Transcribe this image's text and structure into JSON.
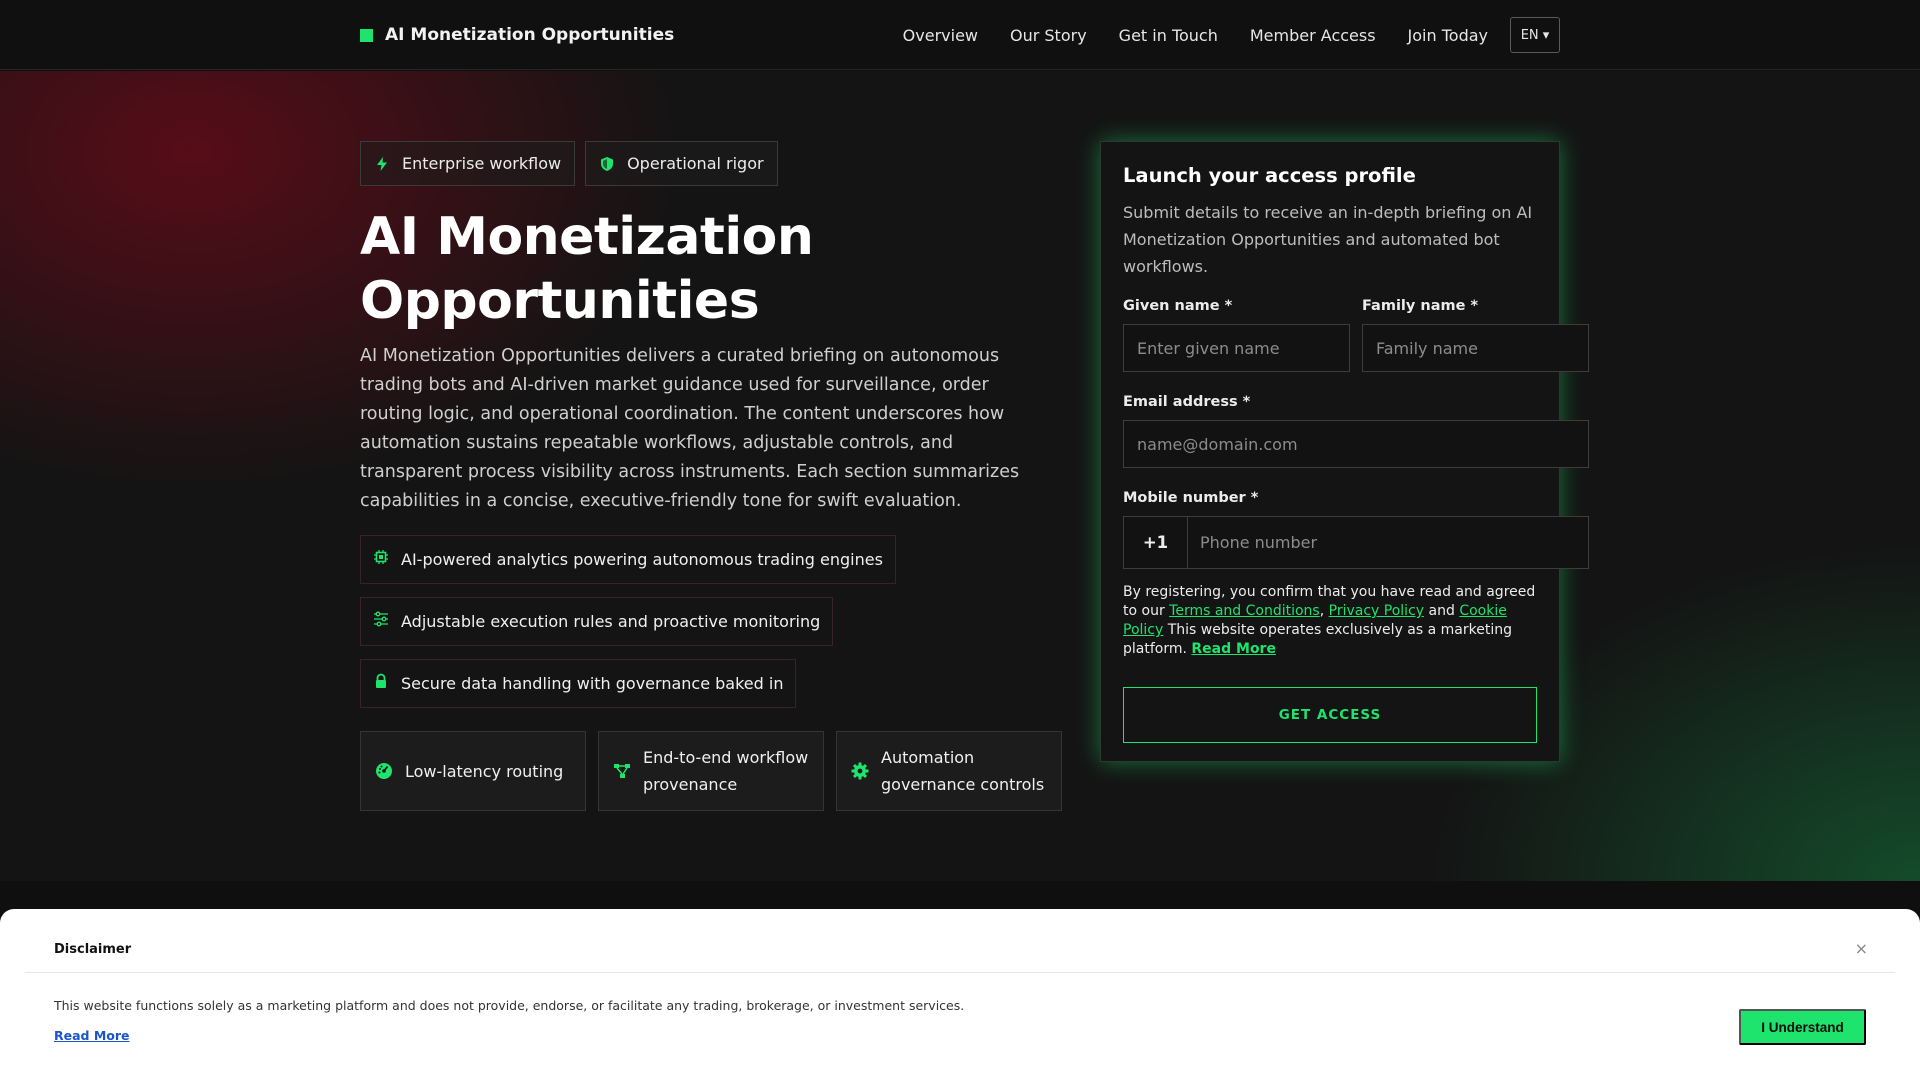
{
  "brand": {
    "name": "AI Monetization Opportunities"
  },
  "nav": {
    "links": [
      "Overview",
      "Our Story",
      "Get in Touch",
      "Member Access",
      "Join Today"
    ],
    "language": "EN ▾"
  },
  "hero": {
    "badges": [
      {
        "label": "Enterprise workflow",
        "icon": "bolt-icon"
      },
      {
        "label": "Operational rigor",
        "icon": "shield-icon"
      }
    ],
    "title": "AI Monetization Opportunities",
    "description": "AI Monetization Opportunities delivers a curated briefing on autonomous trading bots and AI-driven market guidance used for surveillance, order routing logic, and operational coordination. The content underscores how automation sustains repeatable workflows, adjustable controls, and transparent process visibility across instruments. Each section summarizes capabilities in a concise, executive-friendly tone for swift evaluation.",
    "features": [
      {
        "label": "AI-powered analytics powering autonomous trading engines",
        "icon": "chip-icon"
      },
      {
        "label": "Adjustable execution rules and proactive monitoring",
        "icon": "sliders-icon"
      },
      {
        "label": "Secure data handling with governance baked in",
        "icon": "lock-icon"
      }
    ],
    "tiles": [
      {
        "label": "Low-latency routing",
        "icon": "gauge-icon"
      },
      {
        "label": "End-to-end workflow provenance",
        "icon": "flow-icon"
      },
      {
        "label": "Automation governance controls",
        "icon": "gear-icon"
      }
    ]
  },
  "form": {
    "title": "Launch your access profile",
    "subtitle": "Submit details to receive an in-depth briefing on AI Monetization Opportunities and automated bot workflows.",
    "given_name_label": "Given name *",
    "given_name_placeholder": "Enter given name",
    "family_name_label": "Family name *",
    "family_name_placeholder": "Family name",
    "email_label": "Email address *",
    "email_placeholder": "name@domain.com",
    "mobile_label": "Mobile number *",
    "country_code": "+1",
    "phone_placeholder": "Phone number",
    "consent_prefix": "By registering, you confirm that you have read and agreed to our",
    "terms_link": "Terms and Conditions",
    "privacy_link": "Privacy Policy",
    "and_text": "and",
    "cookie_link": "Cookie Policy",
    "consent_suffix": "This website operates exclusively as a marketing platform.",
    "read_more": "Read More",
    "submit_label": "GET ACCESS"
  },
  "disclaimer": {
    "title": "Disclaimer",
    "close": "×",
    "text": "This website functions solely as a marketing platform and does not provide, endorse, or facilitate any trading, brokerage, or investment services.",
    "read_more": "Read More",
    "button": "I Understand"
  },
  "colors": {
    "accent": "#1ee36c",
    "background": "#141414",
    "maroon_glow": "#6e0a19"
  }
}
